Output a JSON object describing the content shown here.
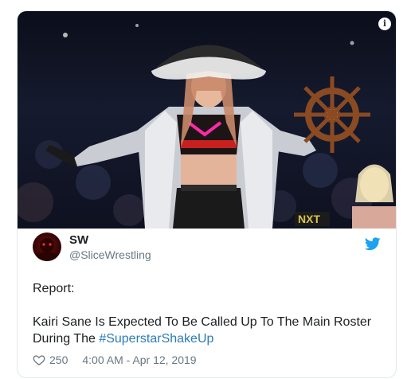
{
  "media": {
    "alt_icon": "info-icon",
    "accent_top_color": "#ff2aa8"
  },
  "author": {
    "display_name": "SW",
    "handle": "@SliceWrestling",
    "avatar_icon": "avatar"
  },
  "tweet": {
    "line1": "Report:",
    "line2": "Kairi Sane Is Expected To Be Called Up To The Main Roster",
    "line3_prefix": "During The ",
    "hashtag": "#SuperstarShakeUp"
  },
  "footer": {
    "likes": "250",
    "timestamp": "4:00 AM - Apr 12, 2019"
  },
  "colors": {
    "link": "#2b7bb9",
    "twitter_blue": "#1da1f2",
    "muted": "#697882"
  }
}
